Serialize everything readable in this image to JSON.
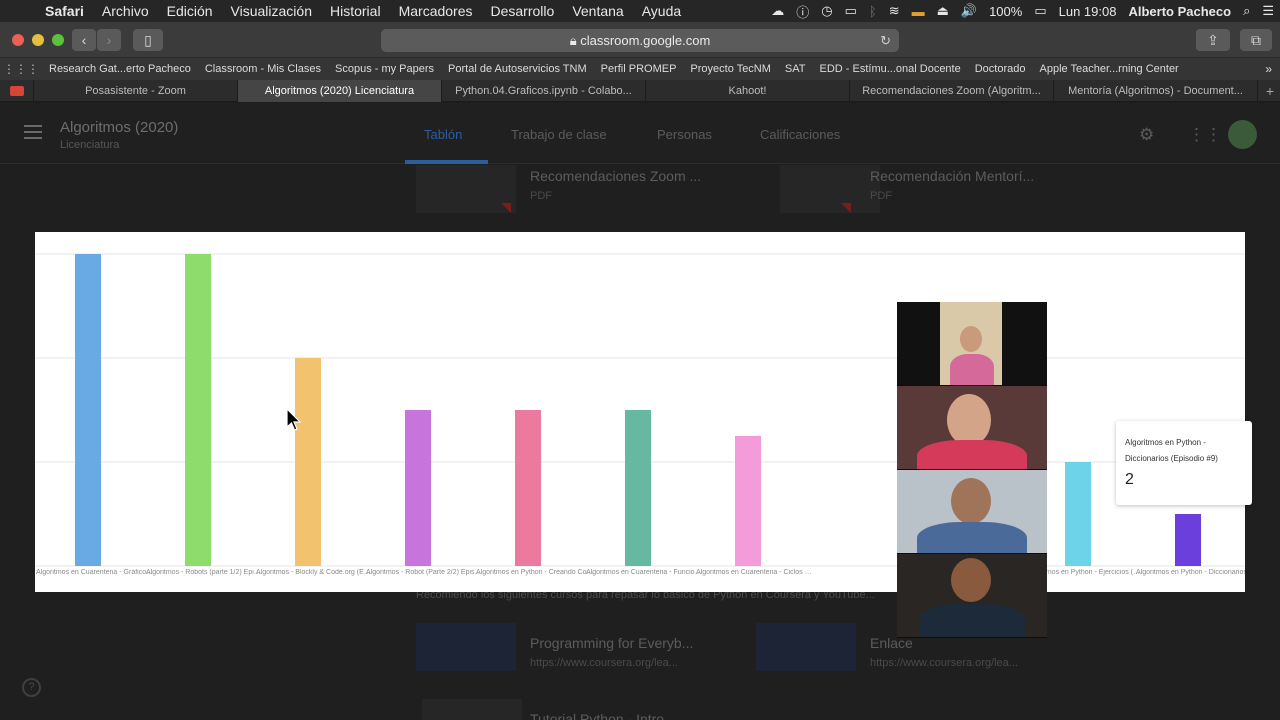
{
  "menubar": {
    "app": "Safari",
    "items": [
      "Archivo",
      "Edición",
      "Visualización",
      "Historial",
      "Marcadores",
      "Desarrollo",
      "Ventana",
      "Ayuda"
    ],
    "battery": "100%",
    "clock": "Lun 19:08",
    "user": "Alberto Pacheco"
  },
  "toolbar": {
    "url": "classroom.google.com"
  },
  "bookmarks": [
    "Research Gat...erto Pacheco",
    "Classroom - Mis Clases",
    "Scopus - my Papers",
    "Portal de Autoservicios TNM",
    "Perfil PROMEP",
    "Proyecto TecNM",
    "SAT",
    "EDD - Estímu...onal Docente",
    "Doctorado",
    "Apple Teacher...rning Center"
  ],
  "tabs": [
    {
      "label": "Posasistente - Zoom",
      "active": false
    },
    {
      "label": "Algoritmos (2020) Licenciatura",
      "active": true
    },
    {
      "label": "Python.04.Graficos.ipynb - Colabo...",
      "active": false
    },
    {
      "label": "Kahoot!",
      "active": false
    },
    {
      "label": "Recomendaciones Zoom (Algoritm...",
      "active": false
    },
    {
      "label": "Mentoría (Algoritmos) - Document...",
      "active": false
    }
  ],
  "classroom": {
    "class_title": "Algoritmos (2020)",
    "class_subtitle": "Licenciatura",
    "nav": [
      "Tablón",
      "Trabajo de clase",
      "Personas",
      "Calificaciones"
    ],
    "attachments": [
      {
        "title": "Recomendaciones Zoom ...",
        "type": "PDF"
      },
      {
        "title": "Recomendación Mentorí...",
        "type": "PDF"
      },
      {
        "title": "Programming for Everyb...",
        "url": "https://www.coursera.org/lea..."
      },
      {
        "title": "Enlace",
        "url": "https://www.coursera.org/lea..."
      }
    ],
    "note": "Recomiendo los siguientes cursos para repasar lo básico de Python en Coursera y YouTube...",
    "bottom_item": "Tutorial Python - Intro..."
  },
  "chart_data": {
    "type": "bar",
    "categories": [
      "Algoritmos en Cuarentena - Gráficos co...",
      "Algoritmos - Robots (parte 1/2) Episo...",
      "Algoritmos - Blockly & Code.org (Episod...",
      "Algoritmos - Robot (Parte 2/2) Episodio 7",
      "Algoritmos en Python - Creando Coman...",
      "Algoritmos en Cuarentena - Funciones (...",
      "Algoritmos en Cuarentena - Ciclos y Dec...",
      "",
      "",
      "Algoritmos en Python - Ejercicios (Episo...",
      "Algoritmos en Python - Diccionarios (E..."
    ],
    "values": [
      6,
      6,
      4,
      3,
      3,
      3,
      2.5,
      null,
      null,
      2,
      1
    ],
    "colors": [
      "#6aaae4",
      "#8ddc6c",
      "#f3c26e",
      "#c774dc",
      "#ec7a9e",
      "#66b8a0",
      "#f39cd9",
      null,
      null,
      "#6dd3e8",
      "#6a3fdc"
    ],
    "ylim": [
      0,
      6
    ],
    "grid": true,
    "tooltip": {
      "label": "Algoritmos en Python - Diccionarios (Episodio #9)",
      "value": "2"
    }
  }
}
